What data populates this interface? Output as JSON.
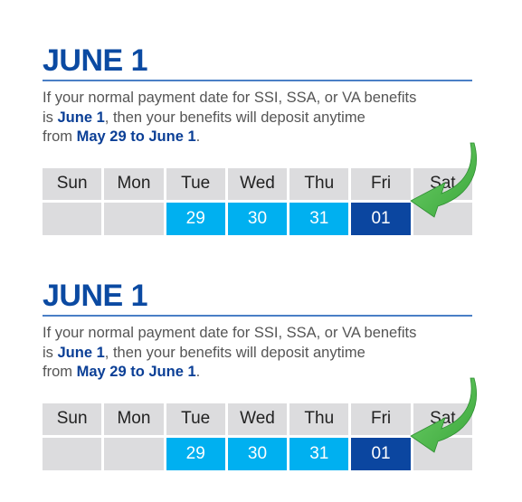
{
  "colors": {
    "title": "#0b4aa2",
    "rule": "#4a7fc6",
    "range_cell": "#00b0f0",
    "target_cell": "#0b46a0",
    "empty_cell": "#dcdcde",
    "arrow": "#4cbb47"
  },
  "sections": [
    {
      "title": "JUNE 1",
      "desc": {
        "line1": "If your normal payment date for SSI, SSA, or VA benefits",
        "line2_pre": "is ",
        "line2_bold": "June 1",
        "line2_post": ", then your benefits will deposit anytime",
        "line3_pre": "from ",
        "line3_bold": "May 29 to June 1",
        "line3_post": "."
      },
      "days": [
        "Sun",
        "Mon",
        "Tue",
        "Wed",
        "Thu",
        "Fri",
        "Sat"
      ],
      "dates": [
        "",
        "",
        "29",
        "30",
        "31",
        "01",
        ""
      ],
      "arrow_icon": "curved-arrow-icon"
    },
    {
      "title": "JUNE 1",
      "desc": {
        "line1": "If your normal payment date for SSI, SSA, or VA benefits",
        "line2_pre": "is ",
        "line2_bold": "June 1",
        "line2_post": ", then your benefits will deposit anytime",
        "line3_pre": "from ",
        "line3_bold": "May 29 to June 1",
        "line3_post": "."
      },
      "days": [
        "Sun",
        "Mon",
        "Tue",
        "Wed",
        "Thu",
        "Fri",
        "Sat"
      ],
      "dates": [
        "",
        "",
        "29",
        "30",
        "31",
        "01",
        ""
      ],
      "arrow_icon": "curved-arrow-icon"
    }
  ]
}
